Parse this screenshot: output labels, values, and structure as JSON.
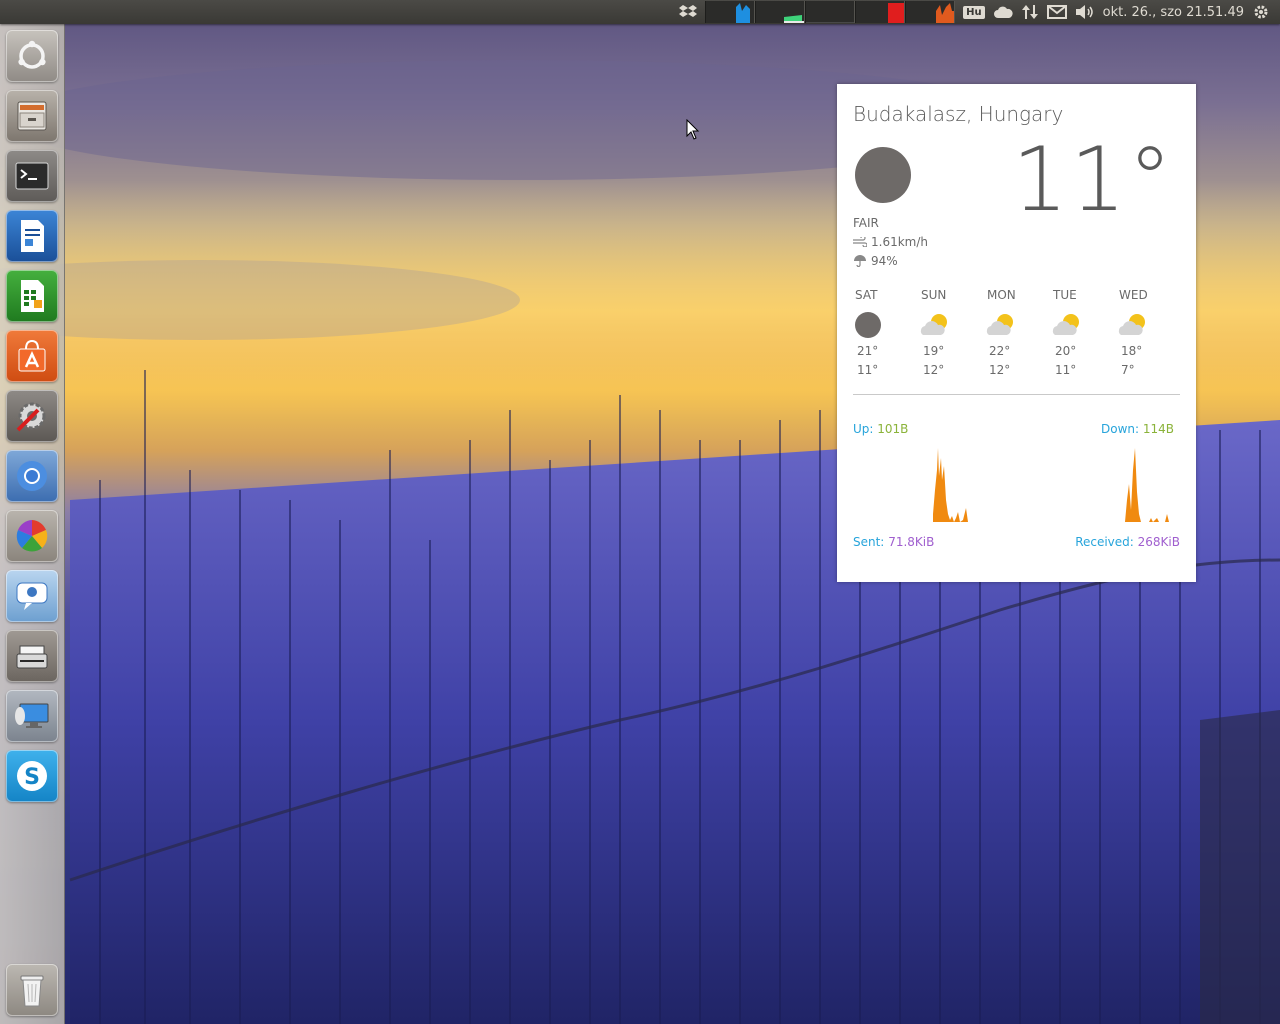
{
  "panel": {
    "keyboard_layout": "Hu",
    "clock": "okt. 26., szo 21.51.49",
    "indicators": [
      "dropbox-icon",
      "system-load-graph",
      "cloud-icon",
      "network-transfer-icon",
      "mail-icon",
      "volume-icon",
      "gear-icon"
    ]
  },
  "launcher": {
    "items": [
      "Ubuntu Dash",
      "Files",
      "Terminal",
      "LibreOffice Writer",
      "LibreOffice Calc",
      "Ubuntu Software Center",
      "System Settings",
      "Chromium",
      "Picasa",
      "Empathy",
      "Simple Scan",
      "Remote Desktop",
      "Skype",
      "Trash"
    ]
  },
  "weather": {
    "location": "Budakalasz, Hungary",
    "temperature": "11°",
    "condition": "FAIR",
    "wind": "1.61km/h",
    "humidity": "94%",
    "forecast": [
      {
        "day": "SAT",
        "icon": "moon-icon",
        "high": "21°",
        "low": "11°"
      },
      {
        "day": "SUN",
        "icon": "partly-cloudy-icon",
        "high": "19°",
        "low": "12°"
      },
      {
        "day": "MON",
        "icon": "partly-cloudy-icon",
        "high": "22°",
        "low": "12°"
      },
      {
        "day": "TUE",
        "icon": "partly-cloudy-icon",
        "high": "20°",
        "low": "11°"
      },
      {
        "day": "WED",
        "icon": "partly-cloudy-icon",
        "high": "18°",
        "low": "7°"
      }
    ]
  },
  "network": {
    "up_label": "Up:",
    "up_value": "101B",
    "down_label": "Down:",
    "down_value": "114B",
    "sent_label": "Sent:",
    "sent_value": "71.8KiB",
    "received_label": "Received:",
    "received_value": "268KiB"
  },
  "colors": {
    "graph_orange": "#f08a10",
    "label_blue": "#27a4db",
    "value_green": "#8bb33a",
    "value_purple": "#a05fcf"
  }
}
